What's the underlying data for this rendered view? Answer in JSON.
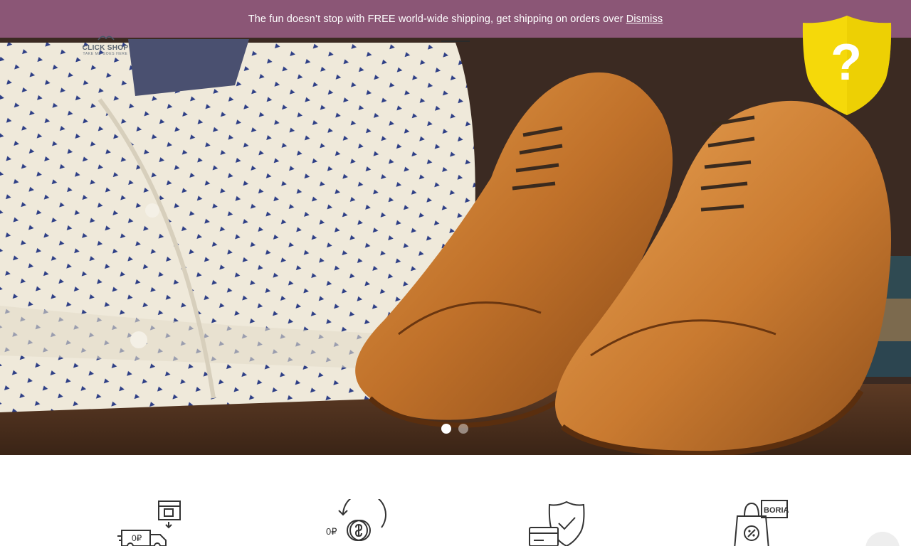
{
  "notice": {
    "message": "The fun doesn’t stop with FREE world-wide shipping, get shipping on orders over",
    "dismiss_label": "Dismiss"
  },
  "brand": {
    "name": "CLICK SHOP",
    "tagline": "TAKE ME GOES HERE"
  },
  "badge": {
    "symbol": "?",
    "icon": "shield-question-icon",
    "color": "#f5d90a"
  },
  "slider": {
    "slides": 2,
    "active": 1
  },
  "features": [
    {
      "icon": "delivery-truck-store-icon",
      "text": "0₽"
    },
    {
      "icon": "coin-return-icon",
      "text": "0₽"
    },
    {
      "icon": "card-shield-check-icon",
      "text": ""
    },
    {
      "icon": "shopping-bag-discount-icon",
      "text": "BORIA"
    }
  ],
  "colors": {
    "notice_bg": "#965c82",
    "accent_yellow": "#f5d90a",
    "leather": "#c0712a"
  }
}
